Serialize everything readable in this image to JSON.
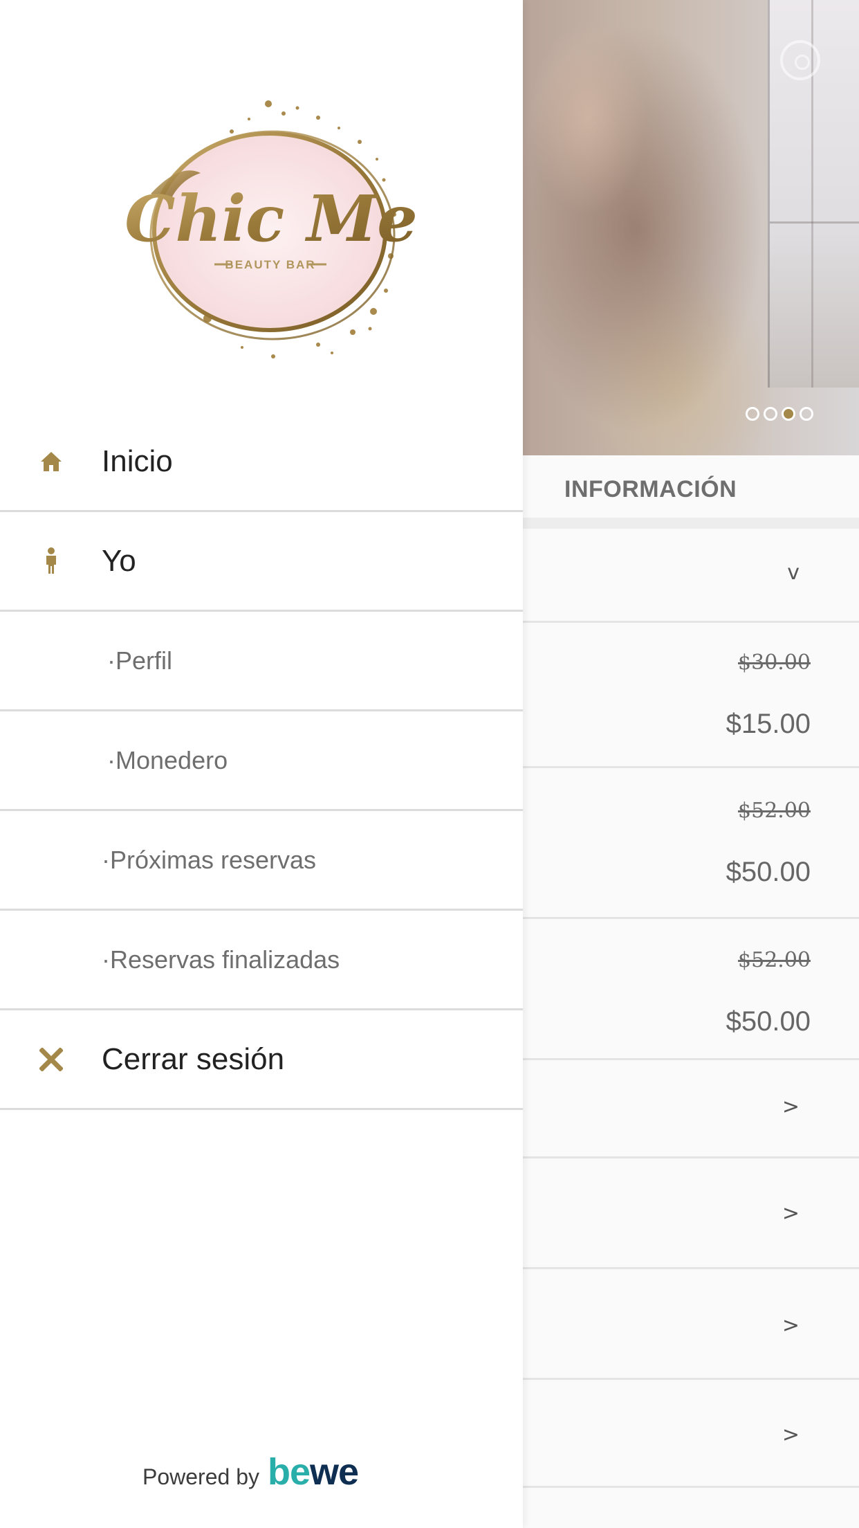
{
  "drawer": {
    "menu": [
      {
        "label": "Inicio",
        "icon": "home-icon",
        "type": "main"
      },
      {
        "label": "Yo",
        "icon": "person-icon",
        "type": "main"
      },
      {
        "label": "·Perfil",
        "type": "sub"
      },
      {
        "label": "·Monedero",
        "type": "sub"
      },
      {
        "label": "·Próximas reservas",
        "type": "sub"
      },
      {
        "label": "·Reservas finalizadas",
        "type": "sub"
      },
      {
        "label": "Cerrar sesión",
        "icon": "close-icon",
        "type": "main"
      }
    ],
    "footer": {
      "powered_by": "Powered by",
      "brand_be": "be",
      "brand_we": "we"
    }
  },
  "background": {
    "carousel": {
      "slides": 4,
      "active_index": 2
    },
    "section_heading": "INFORMACIÓN",
    "prices": [
      {
        "old": "$30.00",
        "new": "$15.00"
      },
      {
        "old": "$52.00",
        "new": "$50.00"
      },
      {
        "old": "$52.00",
        "new": "$50.00"
      }
    ],
    "chevron_down": "v",
    "chevron_right": ">"
  },
  "colors": {
    "accent_gold": "#a48849",
    "bewe_teal": "#2aaeaa",
    "bewe_navy": "#0e2e52"
  }
}
